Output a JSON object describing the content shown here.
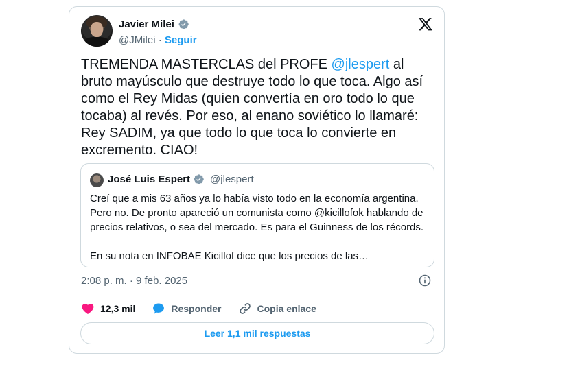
{
  "author": {
    "name": "Javier Milei",
    "handle": "@JMilei",
    "separator": "·",
    "follow_label": "Seguir"
  },
  "tweet": {
    "text_line1_pre": "TREMENDA MASTERCLAS del PROFE ",
    "mention": "@jlespert",
    "text_rest": " al bruto mayúsculo que destruye todo lo que toca. Algo así como el Rey Midas (quien convertía en oro todo lo que tocaba) al revés. Por eso, al enano soviético lo llamaré: Rey SADIM, ya que todo lo que toca lo convierte en excremento. CIAO!"
  },
  "quote": {
    "name": "José Luis Espert",
    "handle": "@jlespert",
    "paragraph1": "Creí que a mis 63 años ya lo había visto todo en la economía argentina. Pero no. De pronto apareció un comunista como @kicillofok hablando de precios relativos, o sea del mercado. Es para el Guinness de los récords.",
    "paragraph2": "En su nota en INFOBAE Kicillof dice que los precios de las…"
  },
  "timestamp": "2:08 p. m. · 9 feb. 2025",
  "actions": {
    "likes": "12,3 mil",
    "reply_label": "Responder",
    "copy_link_label": "Copia enlace"
  },
  "read_replies_label": "Leer 1,1 mil respuestas",
  "colors": {
    "accent": "#1d9bf0",
    "like": "#f91880",
    "text": "#0f1419",
    "muted": "#536471"
  },
  "icons": [
    "verified-badge-icon",
    "x-logo-icon",
    "info-icon",
    "heart-icon",
    "reply-bubble-icon",
    "link-icon"
  ]
}
